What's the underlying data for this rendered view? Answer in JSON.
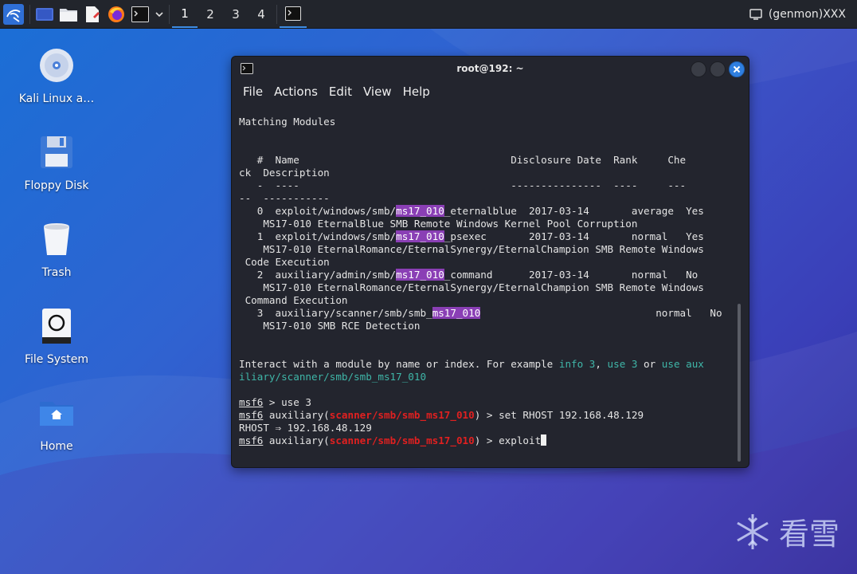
{
  "panel": {
    "workspaces": [
      "1",
      "2",
      "3",
      "4"
    ],
    "genmon_label": "(genmon)XXX"
  },
  "desktop": {
    "icons": [
      {
        "label": "Kali Linux a…",
        "icon": "disc-icon"
      },
      {
        "label": "Floppy Disk",
        "icon": "floppy-icon"
      },
      {
        "label": "Trash",
        "icon": "trash-icon"
      },
      {
        "label": "File System",
        "icon": "drive-icon"
      },
      {
        "label": "Home",
        "icon": "home-folder-icon"
      }
    ]
  },
  "terminal": {
    "title": "root@192: ~",
    "menu": [
      "File",
      "Actions",
      "Edit",
      "View",
      "Help"
    ],
    "search_term": "ms17_010",
    "lines": {
      "heading": "Matching Modules",
      "heading_rule": "================",
      "header1": "   #  Name                                   Disclosure Date  Rank     Che",
      "header2": "ck  Description",
      "rule1": "   -  ----                                   ---------------  ----     ---",
      "rule2": "--  -----------",
      "r0_pre": "   0  exploit/windows/smb/",
      "r0_post": "_eternalblue  2017-03-14       average  Yes",
      "r0_desc": "    MS17-010 EternalBlue SMB Remote Windows Kernel Pool Corruption",
      "r1_pre": "   1  exploit/windows/smb/",
      "r1_post": "_psexec       2017-03-14       normal   Yes",
      "r1_desc": "    MS17-010 EternalRomance/EternalSynergy/EternalChampion SMB Remote Windows",
      "r1_desc2": " Code Execution",
      "r2_pre": "   2  auxiliary/admin/smb/",
      "r2_post": "_command      2017-03-14       normal   No",
      "r2_desc": "    MS17-010 EternalRomance/EternalSynergy/EternalChampion SMB Remote Windows",
      "r2_desc2": " Command Execution",
      "r3_pre": "   3  auxiliary/scanner/smb/smb_",
      "r3_post": "                             normal   No",
      "r3_desc": "    MS17-010 SMB RCE Detection",
      "interact_a": "Interact with a module by name or index. For example ",
      "info3": "info 3",
      "comma": ", ",
      "use3": "use 3",
      "or": " or ",
      "use_aux": "use aux",
      "use_aux2": "iliary/scanner/smb/smb_ms17_010",
      "prompt": "msf6",
      "cmd1": " > use 3",
      "aux_open": " auxiliary(",
      "module": "scanner/smb/smb_ms17_010",
      "aux_close": ") > ",
      "cmd2": "set RHOST 192.168.48.129",
      "rhost_echo": "RHOST ⇒ 192.168.48.129",
      "cmd3": "exploit"
    }
  },
  "watermark": "看雪",
  "colors": {
    "highlight": "#8a3fb5",
    "teal": "#3fb6a8",
    "module_red": "#e02020"
  }
}
